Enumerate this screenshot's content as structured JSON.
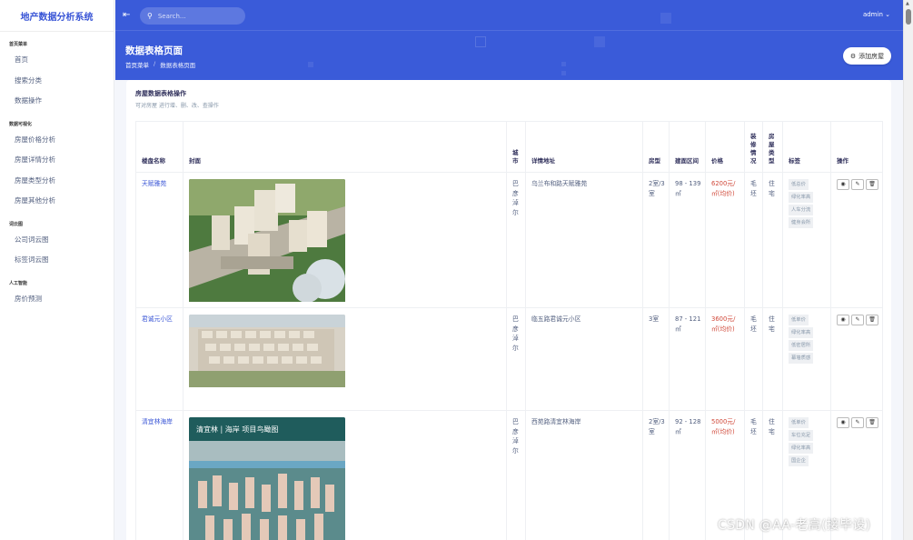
{
  "app": {
    "brand": "地产数据分析系统"
  },
  "sidebar": {
    "groups": [
      {
        "heading": "首页菜单",
        "items": [
          "首页",
          "搜索分类",
          "数据操作"
        ]
      },
      {
        "heading": "数据可视化",
        "items": [
          "房屋价格分析",
          "房屋详情分析",
          "房屋类型分析",
          "房屋其他分析"
        ]
      },
      {
        "heading": "词云图",
        "items": [
          "公司词云图",
          "标签词云图"
        ]
      },
      {
        "heading": "人工智能",
        "items": [
          "房价预测"
        ]
      }
    ]
  },
  "topbar": {
    "search_placeholder": "Search...",
    "user": "admin"
  },
  "header": {
    "page_title": "数据表格页面",
    "breadcrumb": [
      "首页菜单",
      "数据表格页面"
    ],
    "add_button": "添加房屋"
  },
  "card": {
    "title": "房屋数据表格操作",
    "subtitle": "可对房屋 进行增、删、改、查操作"
  },
  "table": {
    "headers": [
      "楼盘名称",
      "封面",
      "城市",
      "详情地址",
      "房型",
      "建面区间",
      "价格",
      "装修情况",
      "房屋类型",
      "标签",
      "操作"
    ],
    "rows": [
      {
        "name": "天赋雅苑",
        "city": "巴彦淖尔",
        "address": "乌兰布和路天赋雅苑",
        "rooms": "2室/3室",
        "area": "98 - 139㎡",
        "price": "6200元/㎡(均价)",
        "decoration": "毛坯",
        "type": "住宅",
        "tags": [
          "低总价",
          "绿化率高",
          "人车分流",
          "健身会所"
        ]
      },
      {
        "name": "君诚元小区",
        "city": "巴彦淖尔",
        "address": "临五路君诚元小区",
        "rooms": "3室",
        "area": "87 - 121㎡",
        "price": "3600元/㎡(均价)",
        "decoration": "毛坯",
        "type": "住宅",
        "tags": [
          "低单价",
          "绿化率高",
          "低密居所",
          "幕墙质感"
        ]
      },
      {
        "name": "清宜林海岸",
        "city": "巴彦淖尔",
        "address": "西苑路清宜林海岸",
        "rooms": "2室/3室",
        "area": "92 - 128㎡",
        "price": "5000元/㎡(均价)",
        "decoration": "毛坯",
        "type": "住宅",
        "tags": [
          "低单价",
          "车位充足",
          "绿化率高",
          "国企企"
        ],
        "cover_banner": "清宜林 | 海岸  项目鸟瞰图"
      }
    ]
  },
  "watermark": "CSDN @AA-老高(接毕设)"
}
